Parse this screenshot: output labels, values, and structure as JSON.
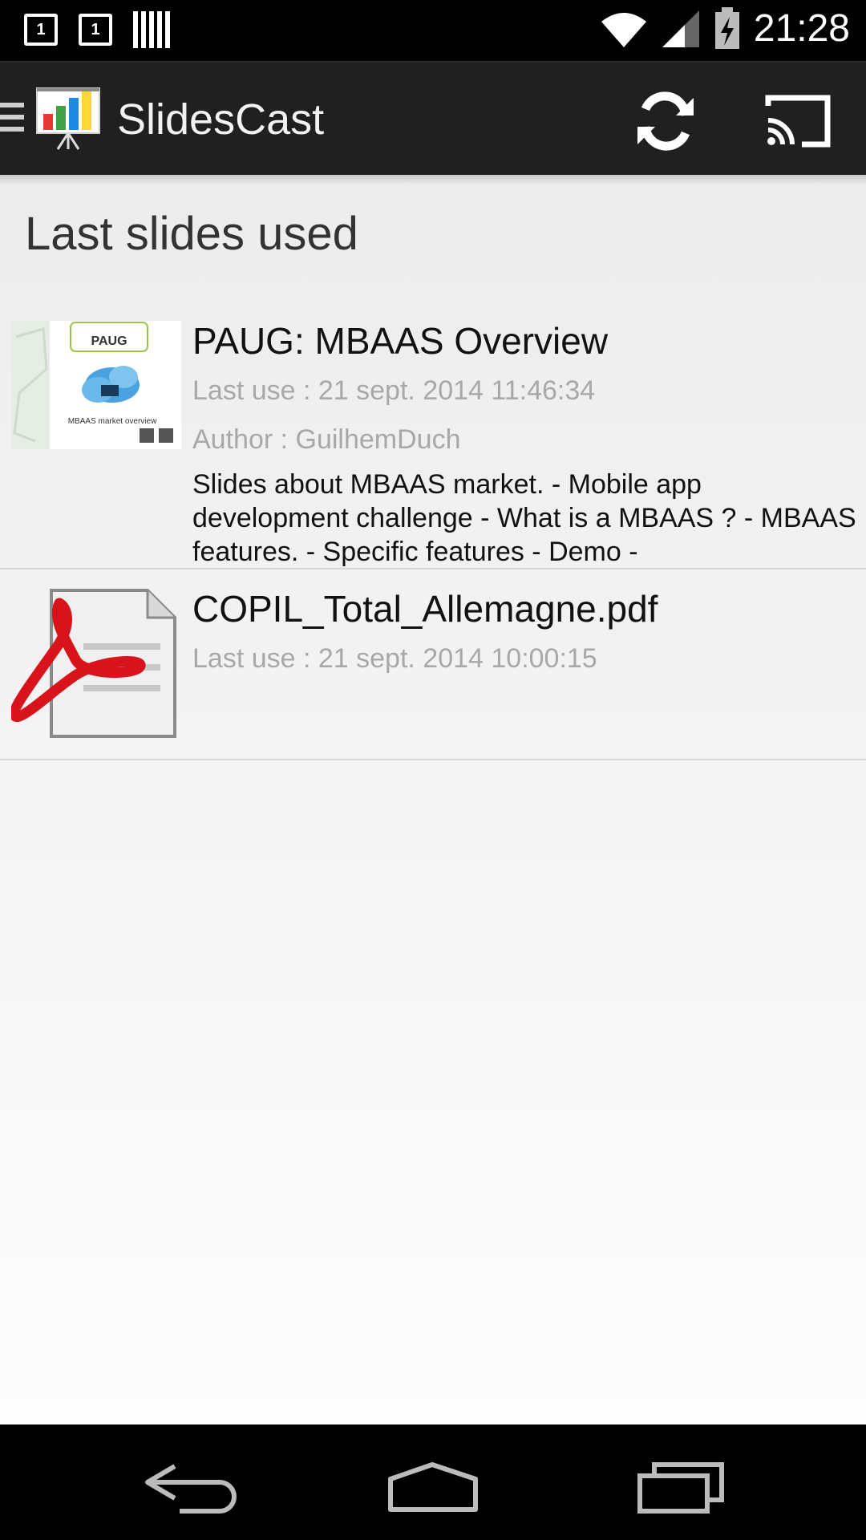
{
  "status_bar": {
    "time": "21:28",
    "sim1_label": "1",
    "sim2_label": "1"
  },
  "app_bar": {
    "title": "SlidesCast"
  },
  "main": {
    "section_title": "Last slides used",
    "items": [
      {
        "title": "PAUG: MBAAS Overview",
        "last_use": "Last use :  21 sept. 2014 11:46:34",
        "author": "Author :  GuilhemDuch",
        "description": "Slides about MBAAS market. - Mobile app development challenge - What is a MBAAS ? - MBAAS features. - Specific features - Demo -",
        "thumb_label_top": "PAUG",
        "thumb_label_bottom": "MBAAS market overview"
      },
      {
        "title": "COPIL_Total_Allemagne.pdf",
        "last_use": "Last use :  21 sept. 2014 10:00:15"
      }
    ]
  },
  "colors": {
    "action_bar": "#202020",
    "background": "#f2f2f2",
    "pdf_red": "#d8131b"
  }
}
